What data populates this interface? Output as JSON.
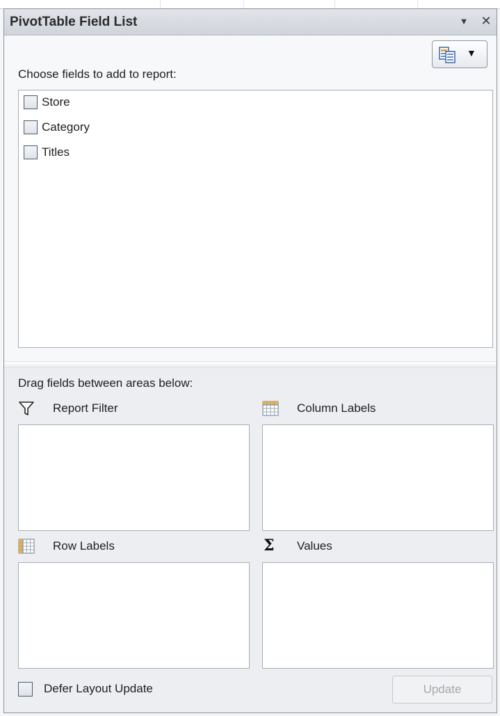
{
  "pane": {
    "title": "PivotTable Field List",
    "menu_glyph": "▼",
    "close_glyph": "✕"
  },
  "view_button": {
    "icon": "field-section-layout-icon",
    "caret": "▼"
  },
  "field_section": {
    "label": "Choose fields to add to report:",
    "fields": [
      {
        "label": "Store",
        "checked": false
      },
      {
        "label": "Category",
        "checked": false
      },
      {
        "label": "Titles",
        "checked": false
      }
    ]
  },
  "areas": {
    "label": "Drag fields between areas below:",
    "report_filter": {
      "label": "Report Filter",
      "icon": "filter-icon"
    },
    "column_labels": {
      "label": "Column Labels",
      "icon": "column-grid-icon"
    },
    "row_labels": {
      "label": "Row Labels",
      "icon": "row-grid-icon"
    },
    "values": {
      "label": "Values",
      "icon": "sigma-icon",
      "glyph": "Σ"
    }
  },
  "footer": {
    "defer_label": "Defer Layout Update",
    "defer_checked": false,
    "update_label": "Update",
    "update_enabled": false
  },
  "colors": {
    "pane_border": "#8d939c",
    "title_bar": "#d6dae0",
    "box_border": "#a7adb6",
    "disabled_text": "#a5a8ad"
  }
}
